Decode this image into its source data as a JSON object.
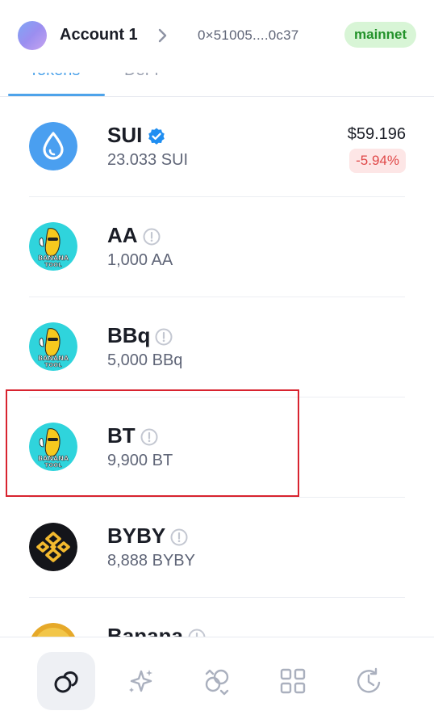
{
  "header": {
    "account_name": "Account 1",
    "address": "0×51005....0c37",
    "network": "mainnet"
  },
  "tabs": [
    {
      "label": "Tokens",
      "active": true
    },
    {
      "label": "DeFi",
      "active": false
    }
  ],
  "tokens": [
    {
      "name": "SUI",
      "balance": "23.033 SUI",
      "usd_value": "$59.196",
      "change": "-5.94%",
      "verified": true,
      "icon": "sui-logo-icon"
    },
    {
      "name": "AA",
      "balance": "1,000 AA",
      "verified": false,
      "icon": "banana-tool-logo-icon"
    },
    {
      "name": "BBq",
      "balance": "5,000 BBq",
      "verified": false,
      "icon": "banana-tool-logo-icon"
    },
    {
      "name": "BT",
      "balance": "9,900 BT",
      "verified": false,
      "icon": "banana-tool-logo-icon",
      "highlighted": true
    },
    {
      "name": "BYBY",
      "balance": "8,888 BYBY",
      "verified": false,
      "icon": "bnb-logo-icon"
    },
    {
      "name": "Banana",
      "balance": "",
      "verified": false,
      "icon": "banana-coin-icon"
    }
  ],
  "colors": {
    "accent": "#4ea3ea",
    "network_bg": "#d8f5d6",
    "network_text": "#23922a",
    "negative_bg": "#fde6e6",
    "negative_text": "#e04848",
    "highlight_border": "#d8232f"
  },
  "bottom_nav": [
    {
      "name": "home-icon",
      "active": true
    },
    {
      "name": "sparkle-icon",
      "active": false
    },
    {
      "name": "swap-icon",
      "active": false
    },
    {
      "name": "apps-grid-icon",
      "active": false
    },
    {
      "name": "history-icon",
      "active": false
    }
  ]
}
